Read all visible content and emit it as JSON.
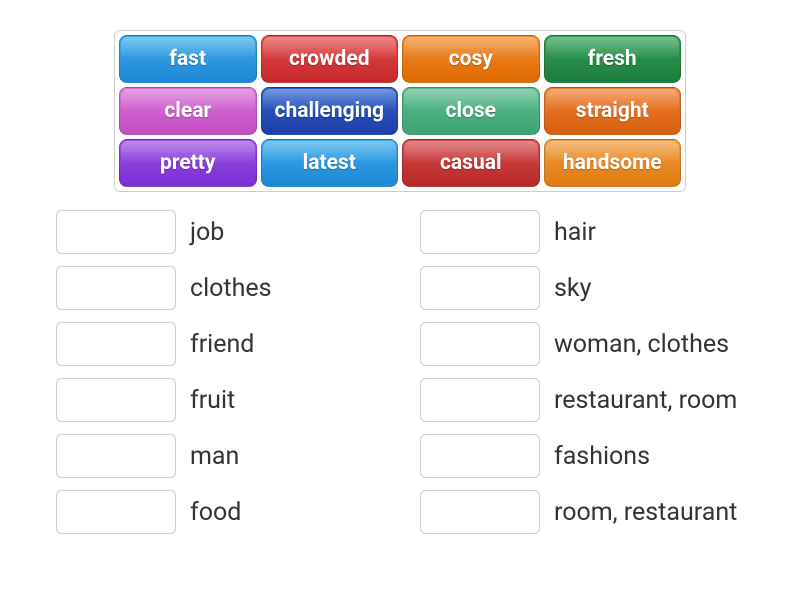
{
  "word_bank": [
    {
      "label": "fast",
      "color": "c-blue"
    },
    {
      "label": "crowded",
      "color": "c-red"
    },
    {
      "label": "cosy",
      "color": "c-orange"
    },
    {
      "label": "fresh",
      "color": "c-green"
    },
    {
      "label": "clear",
      "color": "c-pink"
    },
    {
      "label": "challenging",
      "color": "c-dblue"
    },
    {
      "label": "close",
      "color": "c-teal"
    },
    {
      "label": "straight",
      "color": "c-dorange"
    },
    {
      "label": "pretty",
      "color": "c-purple"
    },
    {
      "label": "latest",
      "color": "c-blue2"
    },
    {
      "label": "casual",
      "color": "c-red2"
    },
    {
      "label": "handsome",
      "color": "c-orange2"
    }
  ],
  "targets": {
    "left": [
      {
        "label": "job"
      },
      {
        "label": "clothes"
      },
      {
        "label": "friend"
      },
      {
        "label": "fruit"
      },
      {
        "label": "man"
      },
      {
        "label": "food"
      }
    ],
    "right": [
      {
        "label": "hair"
      },
      {
        "label": "sky"
      },
      {
        "label": "woman, clothes"
      },
      {
        "label": "restaurant, room"
      },
      {
        "label": "fashions"
      },
      {
        "label": "room, restaurant"
      }
    ]
  }
}
